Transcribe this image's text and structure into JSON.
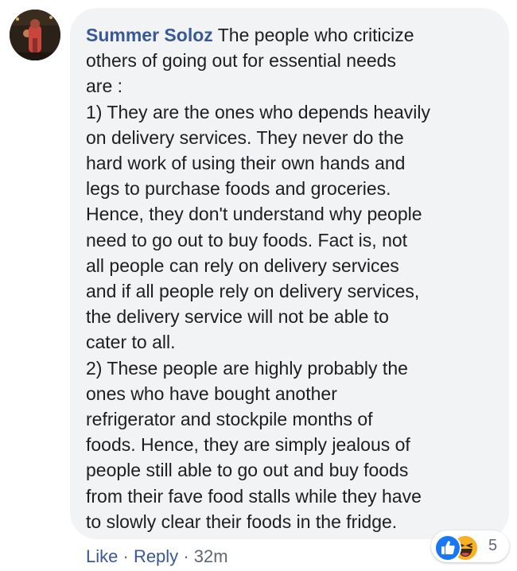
{
  "comment": {
    "author": "Summer Soloz",
    "lines": [
      "The people who criticize",
      "others of going out for essential needs",
      "are :",
      "1) They are the ones who depends heavily",
      "on delivery services. They never do the",
      "hard work of using their own hands and",
      "legs to purchase foods and groceries.",
      "Hence, they don't understand why people",
      "need to go out to buy foods. Fact is, not",
      "all people can rely on delivery services",
      "and if all people rely on delivery services,",
      "the delivery service will not be able to",
      "cater to all.",
      "2) These people are highly probably the",
      "ones who have bought another",
      "refrigerator and stockpile months of",
      "foods. Hence, they are simply jealous of",
      "people still able to go out and buy foods",
      "from their fave food stalls while they have",
      "to slowly clear their foods in the fridge."
    ]
  },
  "actions": {
    "like_label": "Like",
    "reply_label": "Reply",
    "separator": "·",
    "timestamp": "32m"
  },
  "reactions": {
    "count": "5",
    "icons": [
      "like-icon",
      "haha-icon"
    ]
  },
  "colors": {
    "author": "#385898",
    "bubble": "#f2f3f5",
    "text": "#1c1e21",
    "meta": "#606770",
    "like": "#1877f2",
    "haha": "#f7b125"
  }
}
